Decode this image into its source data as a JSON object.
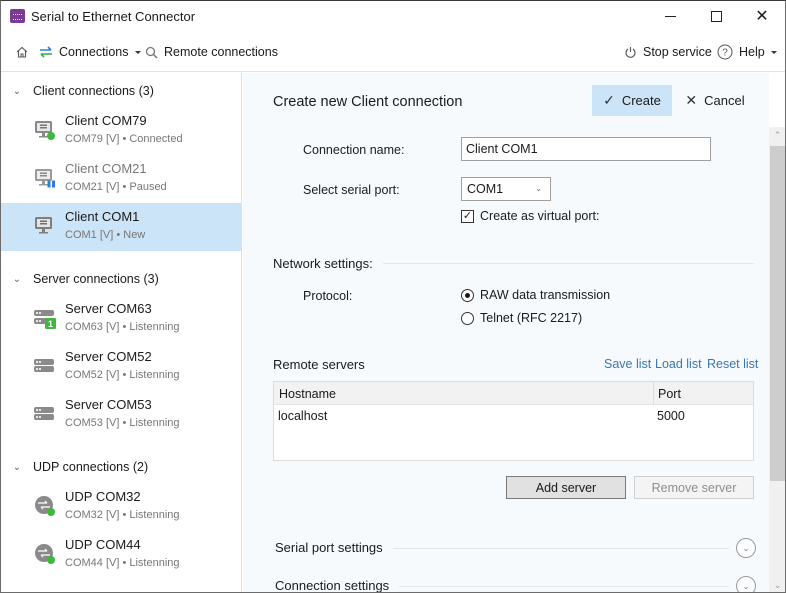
{
  "window": {
    "title": "Serial to Ethernet Connector",
    "controls": {
      "minimize": "minimize",
      "maximize": "maximize",
      "close": "✕"
    }
  },
  "toolbar": {
    "home_icon": "home-icon",
    "connections_label": "Connections",
    "remote_label": "Remote connections",
    "stop_label": "Stop service",
    "help_label": "Help"
  },
  "sidebar": {
    "groups": [
      {
        "label": "Client connections (3)",
        "items": [
          {
            "name": "Client COM79",
            "sub": "COM79 [V] • Connected",
            "icon": "client-monitor-icon",
            "status": "connected"
          },
          {
            "name": "Client COM21",
            "sub": "COM21 [V] • Paused",
            "icon": "client-monitor-icon",
            "status": "paused"
          },
          {
            "name": "Client COM1",
            "sub": "COM1 [V] • New",
            "icon": "client-monitor-icon",
            "status": "new",
            "selected": true
          }
        ]
      },
      {
        "label": "Server connections (3)",
        "items": [
          {
            "name": "Server COM63",
            "sub": "COM63 [V] • Listenning",
            "icon": "server-icon",
            "badge": "1"
          },
          {
            "name": "Server COM52",
            "sub": "COM52 [V] • Listenning",
            "icon": "server-icon"
          },
          {
            "name": "Server COM53",
            "sub": "COM53 [V] • Listenning",
            "icon": "server-icon"
          }
        ]
      },
      {
        "label": "UDP connections (2)",
        "items": [
          {
            "name": "UDP COM32",
            "sub": "COM32 [V] • Listenning",
            "icon": "udp-globe-icon",
            "status": "connected"
          },
          {
            "name": "UDP COM44",
            "sub": "COM44 [V] • Listenning",
            "icon": "udp-globe-icon",
            "status": "connected"
          }
        ]
      }
    ]
  },
  "main": {
    "title": "Create new Client connection",
    "create_label": "Create",
    "cancel_label": "Cancel",
    "connection_name_label": "Connection name:",
    "connection_name_value": "Client COM1",
    "serial_port_label": "Select serial port:",
    "serial_port_value": "COM1",
    "virtual_port_label": "Create as virtual port:",
    "virtual_port_checked": true,
    "network_settings_title": "Network settings:",
    "protocol_label": "Protocol:",
    "protocol_options": [
      {
        "label": "RAW data transmission",
        "checked": true
      },
      {
        "label": "Telnet (RFC 2217)",
        "checked": false
      }
    ],
    "remote_servers_title": "Remote servers",
    "links": {
      "save": "Save list",
      "load": "Load list",
      "reset": "Reset list"
    },
    "table": {
      "columns": [
        "Hostname",
        "Port"
      ],
      "rows": [
        [
          "localhost",
          "5000"
        ]
      ]
    },
    "add_server_label": "Add server",
    "remove_server_label": "Remove server",
    "expanders": [
      "Serial port settings",
      "Connection settings"
    ]
  },
  "colors": {
    "selected_bg": "#cce4f7",
    "accent_link": "#3b77b0",
    "status_green": "#3db83d",
    "status_paused_blue": "#2f7fd6",
    "badge_green": "#3db83d",
    "app_icon_purple": "#7b3a97"
  }
}
